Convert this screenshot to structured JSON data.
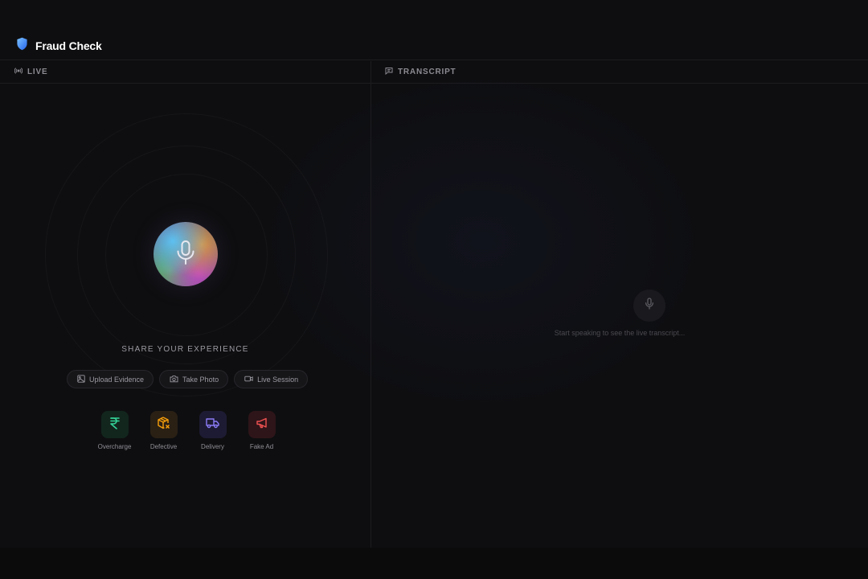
{
  "app": {
    "title": "Fraud Check",
    "brand_color": "#3b82f6"
  },
  "live_panel": {
    "header_label": "LIVE",
    "header_icon": "broadcast-icon",
    "orb_icon": "microphone-icon",
    "prompt": "SHARE YOUR EXPERIENCE",
    "actions": [
      {
        "label": "Upload Evidence",
        "icon": "image-icon"
      },
      {
        "label": "Take Photo",
        "icon": "camera-icon"
      },
      {
        "label": "Live Session",
        "icon": "video-icon"
      }
    ],
    "categories": [
      {
        "label": "Overcharge",
        "icon": "rupee-icon",
        "color": "#34d399",
        "bg": "#12261d"
      },
      {
        "label": "Defective",
        "icon": "package-x-icon",
        "color": "#f59e0b",
        "bg": "#2a2014"
      },
      {
        "label": "Delivery",
        "icon": "truck-icon",
        "color": "#8b7cf6",
        "bg": "#1d1b33"
      },
      {
        "label": "Fake Ad",
        "icon": "megaphone-icon",
        "color": "#f05252",
        "bg": "#2e1519"
      }
    ]
  },
  "transcript_panel": {
    "header_label": "TRANSCRIPT",
    "header_icon": "message-icon",
    "empty_icon": "microphone-icon",
    "empty_text": "Start speaking to see the live transcript..."
  }
}
